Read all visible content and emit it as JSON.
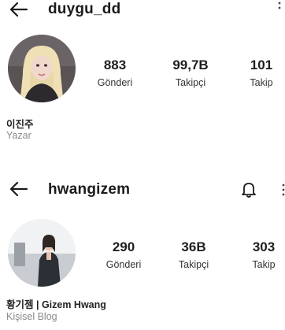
{
  "profiles": [
    {
      "username": "duygu_dd",
      "stats": [
        {
          "value": "883",
          "label": "Gönderi"
        },
        {
          "value": "99,7B",
          "label": "Takipçi"
        },
        {
          "value": "101",
          "label": "Takip"
        }
      ],
      "display_name": "이진주",
      "category": "Yazar"
    },
    {
      "username": "hwangizem",
      "stats": [
        {
          "value": "290",
          "label": "Gönderi"
        },
        {
          "value": "36B",
          "label": "Takipçi"
        },
        {
          "value": "303",
          "label": "Takip"
        }
      ],
      "display_name": "황기젬 | Gizem Hwang",
      "category": "Kişisel Blog"
    }
  ],
  "icons": {
    "back": "arrow-left-icon",
    "more": "more-vertical-icon",
    "notifications": "bell-icon"
  },
  "colors": {
    "text": "#1b1b1b",
    "secondary_text": "#8a8a8a",
    "background": "#ffffff"
  }
}
